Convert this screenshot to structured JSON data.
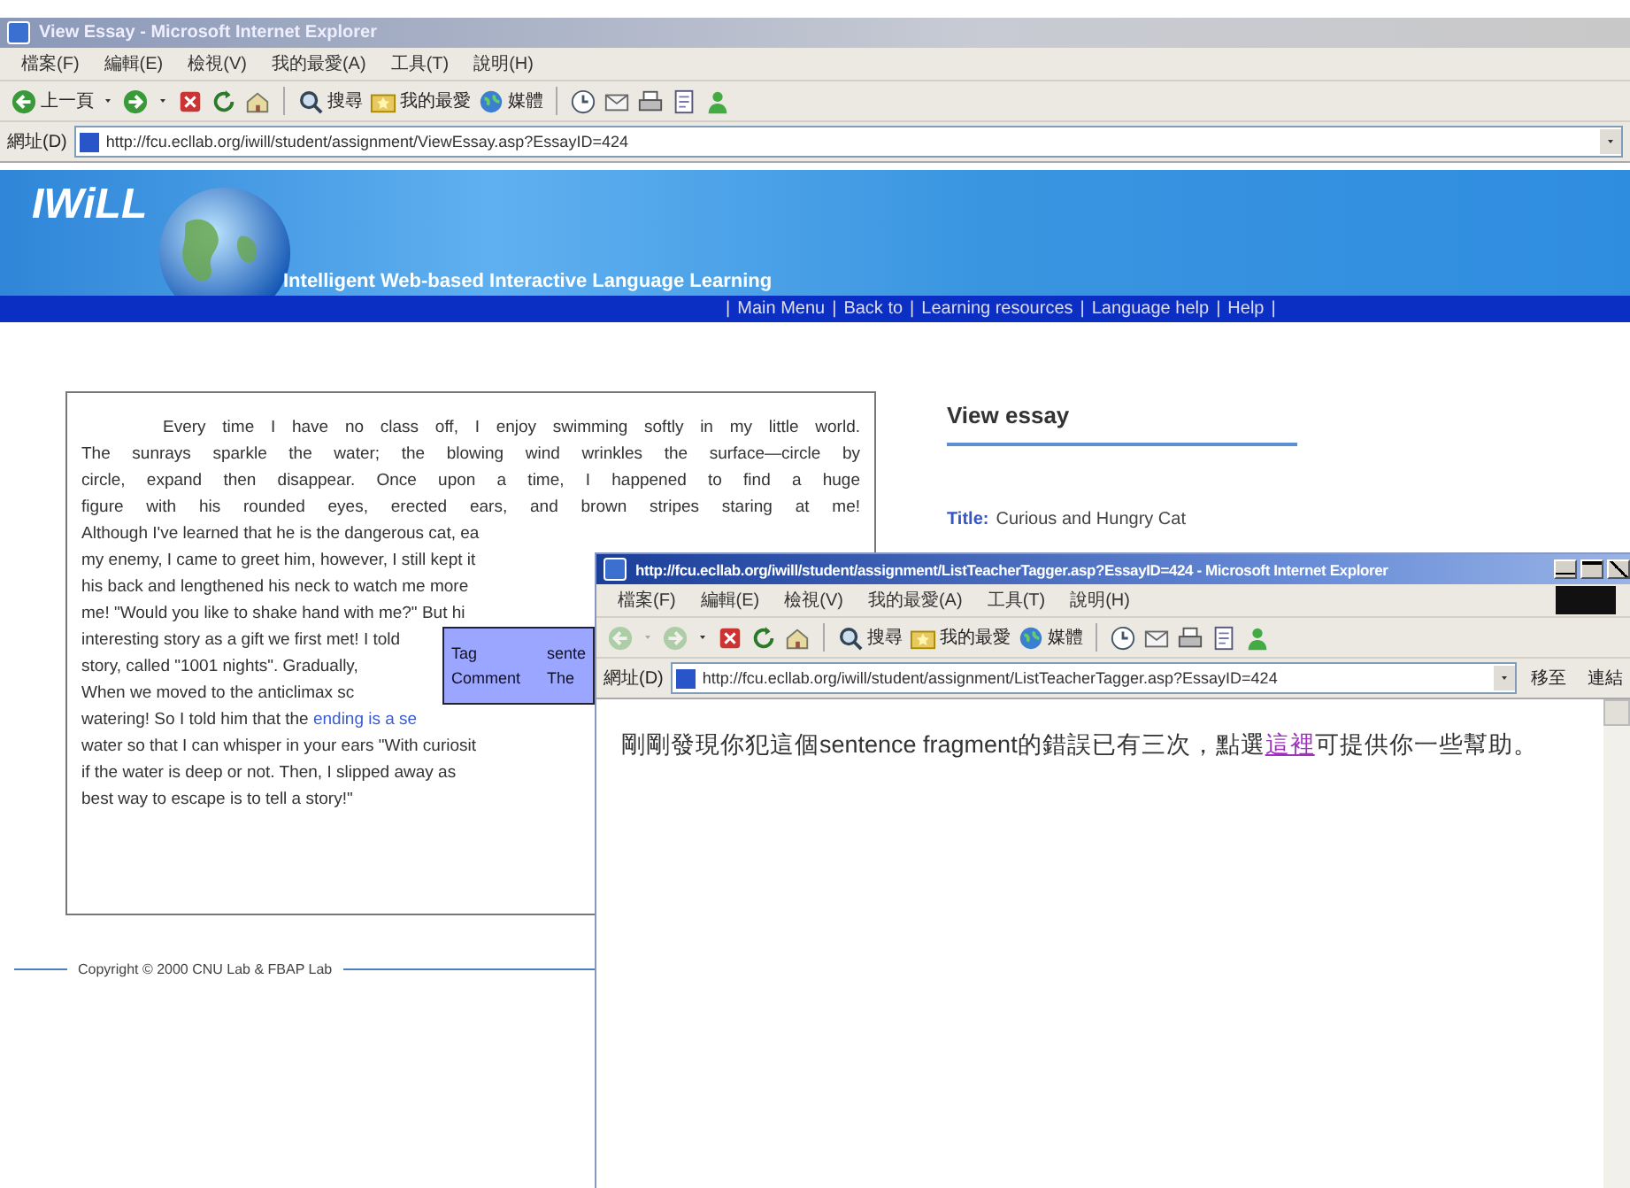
{
  "main_window": {
    "title": "View Essay - Microsoft Internet Explorer",
    "menu": [
      "檔案(F)",
      "編輯(E)",
      "檢視(V)",
      "我的最愛(A)",
      "工具(T)",
      "說明(H)"
    ],
    "toolbar": [
      {
        "kind": "back",
        "label": "上一頁",
        "disabled": false
      },
      {
        "kind": "dropdown",
        "disabled": false
      },
      {
        "kind": "forward",
        "disabled": false
      },
      {
        "kind": "dropdown",
        "disabled": false
      },
      {
        "kind": "stop",
        "disabled": false
      },
      {
        "kind": "refresh",
        "disabled": false
      },
      {
        "kind": "home",
        "disabled": false
      },
      {
        "kind": "search",
        "label": "搜尋",
        "disabled": false
      },
      {
        "kind": "favorites",
        "label": "我的最愛",
        "disabled": false
      },
      {
        "kind": "media",
        "label": "媒體",
        "disabled": false
      },
      {
        "kind": "history",
        "disabled": false
      },
      {
        "kind": "mail",
        "disabled": false
      },
      {
        "kind": "print",
        "disabled": false
      },
      {
        "kind": "edit",
        "disabled": false
      },
      {
        "kind": "messenger",
        "disabled": false
      }
    ],
    "address": {
      "label": "網址(D)",
      "url": "http://fcu.ecllab.org/iwill/student/assignment/ViewEssay.asp?EssayID=424"
    }
  },
  "banner": {
    "logo": "IWiLL",
    "subtitle": "Intelligent Web-based Interactive Language Learning",
    "separator": "|",
    "nav": [
      "Main Menu",
      "Back to",
      "Learning resources",
      "Language help",
      "Help"
    ]
  },
  "essay": {
    "lines": [
      {
        "kind": "first",
        "text": "Every time I have no class off, I enjoy swimming softly in my little world."
      },
      {
        "kind": "full",
        "text": "The sunrays sparkle the water; the blowing wind wrinkles the surface—circle by"
      },
      {
        "kind": "full",
        "text": "circle, expand then disappear. Once upon a time, I happened to find a huge"
      },
      {
        "kind": "full",
        "text": "figure with his rounded eyes, erected ears, and brown stripes staring at me!"
      },
      {
        "kind": "cut",
        "text": "Although I've learned that he is the dangerous cat, ea"
      },
      {
        "kind": "cut",
        "text": "my enemy, I came to greet him, however, I still kept it"
      },
      {
        "kind": "cut",
        "text": "his back and lengthened his neck to watch me more"
      },
      {
        "kind": "cut",
        "text": "me! \"Would you like to shake hand with me?\" But hi"
      },
      {
        "kind": "cut",
        "text": "interesting story as a gift we first met! I told"
      },
      {
        "kind": "cut",
        "text": "story, called \"1001 nights\". Gradually,"
      },
      {
        "kind": "cut",
        "text": "When we moved to the anticlimax sc"
      },
      {
        "kind": "cut",
        "text": "watering! So I told him that the ",
        "link": "ending is a se"
      },
      {
        "kind": "cut",
        "text": "water so that I can whisper in your ears \"With curiosit"
      },
      {
        "kind": "cut",
        "text": "if the water is deep or not. Then, I slipped away as"
      },
      {
        "kind": "last",
        "text": "best way to escape is to tell a story!\""
      }
    ]
  },
  "tooltip": {
    "rows": [
      {
        "label": "Tag",
        "value": "sente"
      },
      {
        "label": "Comment",
        "value": "The"
      }
    ]
  },
  "view": {
    "heading": "View essay",
    "title_label": "Title:",
    "title": "Curious and Hungry Cat"
  },
  "footer": "Copyright © 2000 CNU Lab & FBAP Lab",
  "popup": {
    "title": "http://fcu.ecllab.org/iwill/student/assignment/ListTeacherTagger.asp?EssayID=424 - Microsoft Internet Explorer",
    "menu": [
      "檔案(F)",
      "編輯(E)",
      "檢視(V)",
      "我的最愛(A)",
      "工具(T)",
      "說明(H)"
    ],
    "toolbar": [
      {
        "kind": "back",
        "disabled": true
      },
      {
        "kind": "dropdown",
        "disabled": true
      },
      {
        "kind": "forward",
        "disabled": true
      },
      {
        "kind": "dropdown",
        "disabled": false
      },
      {
        "kind": "stop",
        "disabled": false
      },
      {
        "kind": "refresh",
        "disabled": false
      },
      {
        "kind": "home",
        "disabled": false
      },
      {
        "kind": "search",
        "label": "搜尋",
        "disabled": false
      },
      {
        "kind": "favorites",
        "label": "我的最愛",
        "disabled": false
      },
      {
        "kind": "media",
        "label": "媒體",
        "disabled": false
      },
      {
        "kind": "history",
        "disabled": false
      },
      {
        "kind": "mail",
        "disabled": false
      },
      {
        "kind": "print",
        "disabled": false
      },
      {
        "kind": "edit",
        "disabled": false
      },
      {
        "kind": "messenger",
        "disabled": false
      }
    ],
    "address": {
      "label": "網址(D)",
      "url": "http://fcu.ecllab.org/iwill/student/assignment/ListTeacherTagger.asp?EssayID=424",
      "go": "移至",
      "links": "連結"
    },
    "message": {
      "before": "剛剛發現你犯這個sentence fragment的錯誤已有三次，點選",
      "link": "這裡",
      "after": "可提供你一些幫助。"
    }
  }
}
